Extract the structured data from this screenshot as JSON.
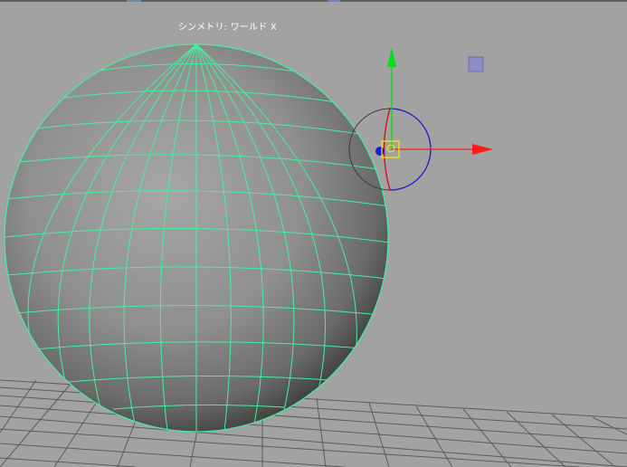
{
  "viewport": {
    "symmetry_label": "シンメトリ: ワールド X",
    "colors": {
      "background": "#a2a2a2",
      "grid": "#5b5b5b",
      "wireframe": "#43f0a0",
      "x_axis": "#ff1a1a",
      "y_axis": "#00e11a",
      "z_ring": "#1a1ad6",
      "pivot_handle": "#f0f000",
      "camera_ring": "#3a3a3a"
    },
    "icons": {
      "manipulator": "move-rotate-manipulator-icon",
      "free_move": "free-move-square-icon"
    }
  }
}
